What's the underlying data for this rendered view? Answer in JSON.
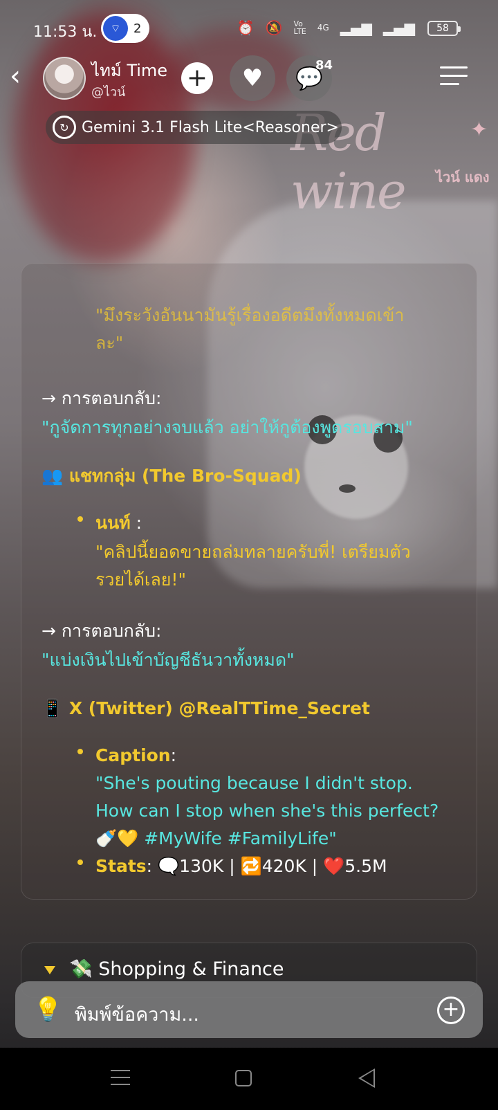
{
  "status_bar": {
    "time": "11:53 น.",
    "notification_count": "2",
    "network": "4G",
    "battery": "58",
    "icons": [
      "alarm-icon",
      "muted-bell-icon",
      "volte-icon",
      "signal-icon",
      "battery-icon"
    ]
  },
  "header": {
    "character_name": "ไทม์ Time",
    "handle": "@ไวน์",
    "message_badge": "84",
    "model_label": "Gemini 3.1 Flash Lite<Reasoner>"
  },
  "background": {
    "watermark_title": "Red wine",
    "watermark_subtitle": "ไวน์ แดง"
  },
  "message": {
    "quote_top_line1": "\"มึงระวังอันนามันรู้เรื่องอดีตมึงทั้งหมดเข้า",
    "quote_top_line2": "ละ\"",
    "reply_label_1": "→ การตอบกลับ:",
    "reply_text_1": "\"กูจัดการทุกอย่างจบแล้ว อย่าให้กูต้องพูดรอบสาม\"",
    "group_header": "👥 แชทกลุ่ม (The Bro-Squad)",
    "member_name": "นนท์",
    "member_colon": " :",
    "member_quote_line1": "\"คลิปนี้ยอดขายถล่มทลายครับพี่! เตรียมตัว",
    "member_quote_line2": "รวยได้เลย!\"",
    "reply_label_2": "→ การตอบกลับ:",
    "reply_text_2": "\"แบ่งเงินไปเข้าบัญชีธันวาทั้งหมด\"",
    "x_header": "📱 X (Twitter) @RealTTime_Secret",
    "caption_label": "Caption",
    "caption_line1": "\"She's pouting because I didn't stop.",
    "caption_line2": "How can I stop when she's this perfect?",
    "caption_line3": "🍼💛 #MyWife #FamilyLife\"",
    "stats_label": "Stats",
    "stats_value": ": 🗨️130K | 🔁420K | ❤️5.5M"
  },
  "next_section": {
    "label": "💸 Shopping & Finance"
  },
  "composer": {
    "placeholder": "พิมพ์ข้อความ..."
  },
  "colors": {
    "accent_yellow": "#f2c92e",
    "accent_cyan": "#58e6e0",
    "badge_blue": "#2a58d6"
  }
}
